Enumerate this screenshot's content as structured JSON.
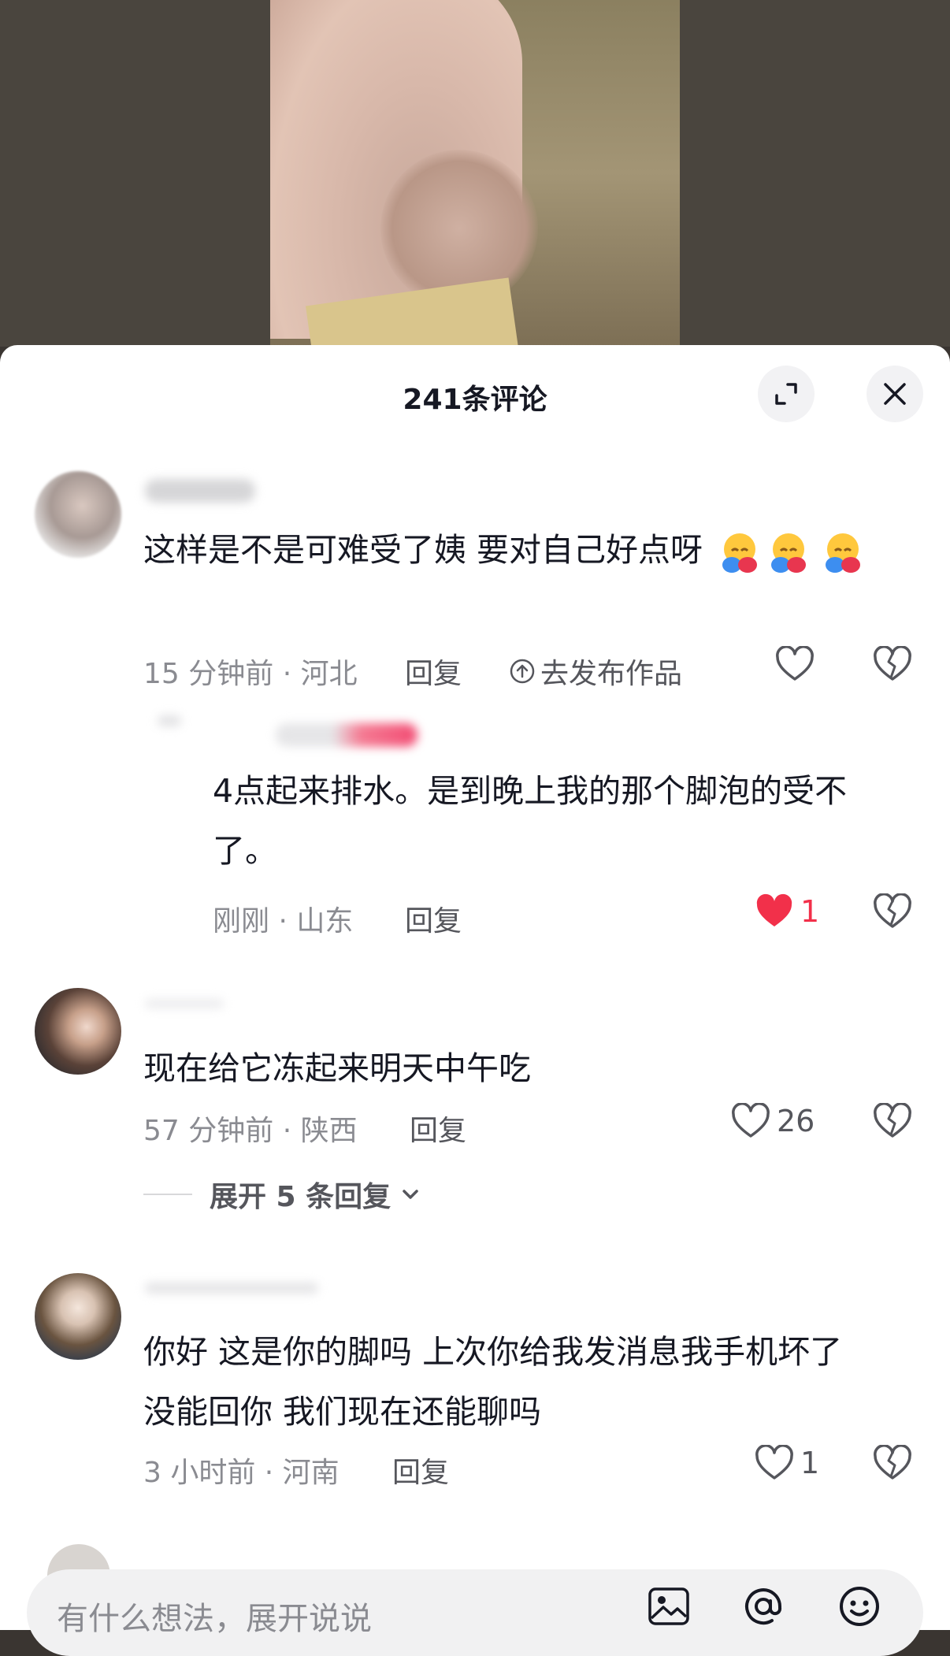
{
  "sheet": {
    "title": "241条评论"
  },
  "comments": [
    {
      "text": "这样是不是可难受了姨 要对自己好点呀",
      "emoji_count": 3,
      "meta": "15 分钟前 · 河北",
      "reply_label": "回复",
      "publish_label": "去发布作品",
      "like_count": "",
      "replies": [
        {
          "text": "4点起来排水。是到晚上我的那个脚泡的受不了。",
          "meta": "刚刚 · 山东",
          "reply_label": "回复",
          "like_count": "1",
          "liked": true
        }
      ]
    },
    {
      "text": "现在给它冻起来明天中午吃",
      "meta": "57 分钟前 · 陕西",
      "reply_label": "回复",
      "like_count": "26",
      "expand_label": "展开 5 条回复"
    },
    {
      "text": "你好 这是你的脚吗 上次你给我发消息我手机坏了 没能回你 我们现在还能聊吗",
      "meta": "3 小时前 · 河南",
      "reply_label": "回复",
      "like_count": "1"
    }
  ],
  "input": {
    "placeholder": "有什么想法，展开说说"
  },
  "colors": {
    "liked": "#f2304a",
    "muted": "#8a8b91"
  }
}
